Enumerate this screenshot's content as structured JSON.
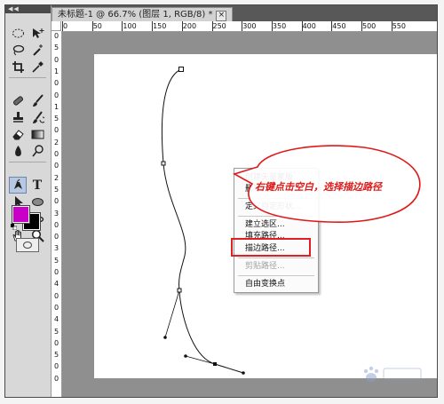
{
  "document": {
    "tab_title": "未标题-1 @ 66.7% (图层 1, RGB/8) *",
    "close_glyph": "×"
  },
  "toolbar": {
    "grip_label": "◀◀",
    "tools": [
      {
        "icon": "marquee-icon"
      },
      {
        "icon": "move-icon"
      },
      {
        "icon": "lasso-icon"
      },
      {
        "icon": "magic-wand-icon"
      },
      {
        "icon": "crop-icon"
      },
      {
        "icon": "eyedropper-icon"
      },
      {
        "icon": "healing-brush-icon"
      },
      {
        "icon": "brush-icon"
      },
      {
        "icon": "clone-stamp-icon"
      },
      {
        "icon": "history-brush-icon"
      },
      {
        "icon": "eraser-icon"
      },
      {
        "icon": "gradient-icon"
      },
      {
        "icon": "blur-icon"
      },
      {
        "icon": "dodge-icon"
      },
      {
        "icon": "pen-icon",
        "active": true
      },
      {
        "icon": "type-icon"
      },
      {
        "icon": "path-selection-icon"
      },
      {
        "icon": "ellipse-icon"
      },
      {
        "icon": "3d-rotate-icon"
      },
      {
        "icon": "3d-orbit-icon"
      },
      {
        "icon": "hand-icon"
      },
      {
        "icon": "zoom-icon"
      }
    ],
    "type_tool_glyph": "T",
    "foreground_color": "#c800c8",
    "background_color": "#000000"
  },
  "rulers": {
    "top": [
      "0",
      "50",
      "100",
      "150",
      "200",
      "250",
      "300",
      "350",
      "400",
      "450",
      "500",
      "550"
    ],
    "left": [
      "0",
      "5",
      "0",
      "1",
      "0",
      "0",
      "1",
      "5",
      "0",
      "2",
      "0",
      "0",
      "2",
      "5",
      "0",
      "3",
      "0",
      "0",
      "3",
      "5",
      "0",
      "4",
      "0",
      "0",
      "4",
      "5",
      "0",
      "5",
      "0",
      "0"
    ]
  },
  "context_menu": {
    "items": [
      {
        "label": "创建矢量蒙版",
        "disabled": false
      },
      {
        "label": "删除路径",
        "disabled": false
      },
      {
        "label": "定义自定形状...",
        "disabled": false
      },
      {
        "label": "建立选区...",
        "disabled": false
      },
      {
        "label": "填充路径...",
        "disabled": false
      },
      {
        "label": "描边路径...",
        "disabled": false,
        "highlighted": true
      },
      {
        "label": "剪贴路径...",
        "disabled": true
      },
      {
        "label": "自由变换点",
        "disabled": false
      }
    ]
  },
  "annotation": {
    "text": "右键点击空白，选择描边路径",
    "color": "#e01818"
  }
}
